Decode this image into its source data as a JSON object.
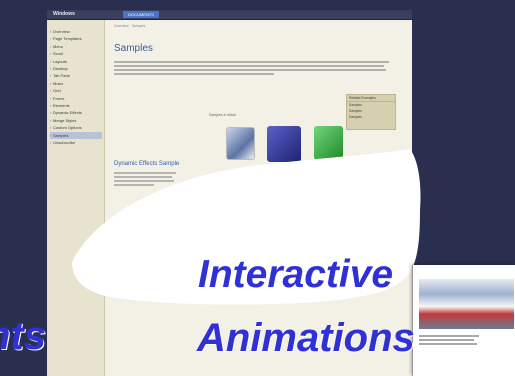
{
  "browser": {
    "brand": "Windows",
    "active_tab": "DOCUMENTS"
  },
  "sidebar": {
    "items": [
      {
        "label": "Overview"
      },
      {
        "label": "Page Templates"
      },
      {
        "label": "Menu"
      },
      {
        "label": "Scroll"
      },
      {
        "label": "Layouts"
      },
      {
        "label": "Desktop"
      },
      {
        "label": "Tab Pane"
      },
      {
        "label": "Motor"
      },
      {
        "label": "Grid"
      },
      {
        "label": "Forms"
      },
      {
        "label": "Elements"
      },
      {
        "label": "Dynamic Effects"
      },
      {
        "label": "Merge Styles"
      },
      {
        "label": "Custom Options"
      },
      {
        "label": "Samples",
        "active": true
      },
      {
        "label": "Unsubscribe"
      }
    ]
  },
  "main": {
    "breadcrumb": "Overview · Samples",
    "title": "Samples",
    "subtitle": "Samples in detail",
    "thumb_captions": [
      "",
      "",
      ""
    ],
    "section_title": "Dynamic Effects Sample",
    "bottom_note": ""
  },
  "right_box": {
    "title": "Related Examples",
    "items": [
      "Samples",
      "Samples",
      "Samples"
    ]
  },
  "overlay": {
    "line1": "Interactive",
    "line2": "Animations",
    "left_fragment": "nts"
  },
  "preview": {
    "note": ""
  }
}
